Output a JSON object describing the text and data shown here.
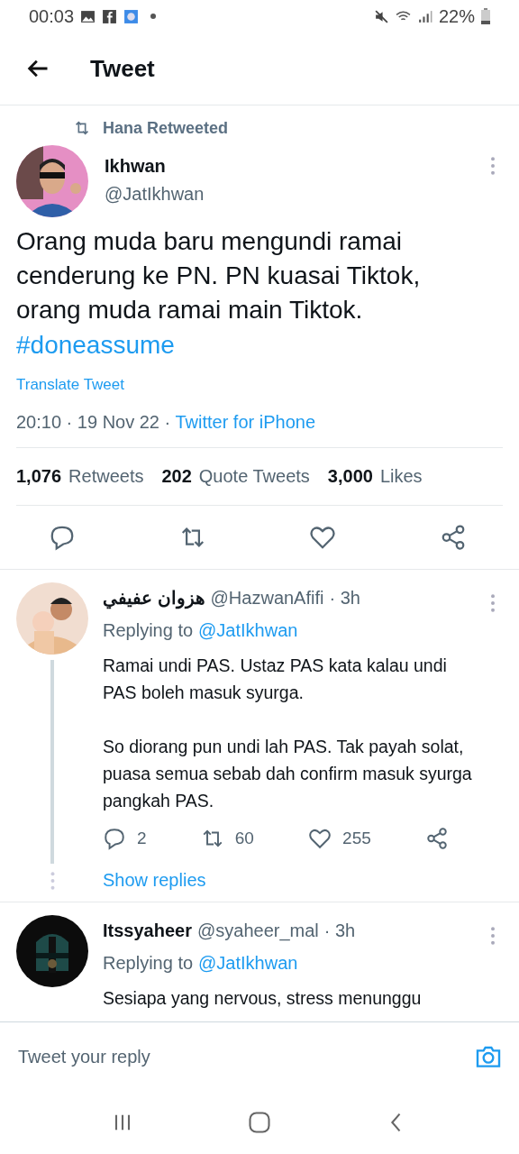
{
  "status_bar": {
    "time": "00:03",
    "battery": "22%"
  },
  "header": {
    "title": "Tweet"
  },
  "tweet": {
    "retweeted_by": "Hana Retweeted",
    "author": {
      "name": "Ikhwan",
      "handle": "@JatIkhwan"
    },
    "text": "Orang muda baru mengundi ramai cenderung ke PN. PN kuasai Tiktok, orang muda ramai main Tiktok.",
    "hashtag": "#doneassume",
    "translate": "Translate Tweet",
    "meta": "20:10 · 19 Nov 22 · ",
    "source": "Twitter for iPhone",
    "stats": [
      {
        "count": "1,076",
        "label": "Retweets"
      },
      {
        "count": "202",
        "label": "Quote Tweets"
      },
      {
        "count": "3,000",
        "label": "Likes"
      }
    ]
  },
  "replies": [
    {
      "name": "هزوان عفيفي",
      "handle": "@HazwanAfifi",
      "time": "· 3h",
      "replying_label": "Replying to",
      "replying_to": "@JatIkhwan",
      "paragraphs": [
        "Ramai undi PAS. Ustaz PAS kata kalau undi PAS boleh masuk syurga.",
        "So diorang pun undi lah PAS. Tak payah solat, puasa semua sebab dah confirm masuk syurga pangkah PAS."
      ],
      "replies_count": "2",
      "retweets_count": "60",
      "likes_count": "255",
      "show_replies": "Show replies"
    },
    {
      "name": "Itssyaheer",
      "handle": "@syaheer_mal",
      "time": "· 3h",
      "replying_label": "Replying to",
      "replying_to": "@JatIkhwan",
      "paragraphs": [
        "Sesiapa yang nervous, stress menunggu"
      ]
    }
  ],
  "reply_bar": {
    "placeholder": "Tweet your reply"
  }
}
